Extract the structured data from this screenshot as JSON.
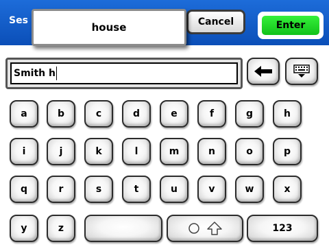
{
  "header": {
    "session_label": "Ses",
    "suggestion": "house",
    "cancel_label": "Cancel",
    "enter_label": "Enter"
  },
  "input": {
    "value": "Smith h"
  },
  "keyboard": {
    "rows": [
      [
        "a",
        "b",
        "c",
        "d",
        "e",
        "f",
        "g",
        "h"
      ],
      [
        "i",
        "j",
        "k",
        "l",
        "m",
        "n",
        "o",
        "p"
      ],
      [
        "q",
        "r",
        "s",
        "t",
        "u",
        "v",
        "w",
        "x"
      ]
    ],
    "last_row_letters": [
      "y",
      "z"
    ],
    "numeric_label": "123"
  },
  "icons": {
    "backspace": "backspace-arrow-icon",
    "hide_keyboard": "keyboard-hide-icon",
    "shift": "shift-icon",
    "toggle": "toggle-circle-icon"
  },
  "colors": {
    "header_blue": "#0b56c4",
    "enter_green": "#1fd628"
  }
}
